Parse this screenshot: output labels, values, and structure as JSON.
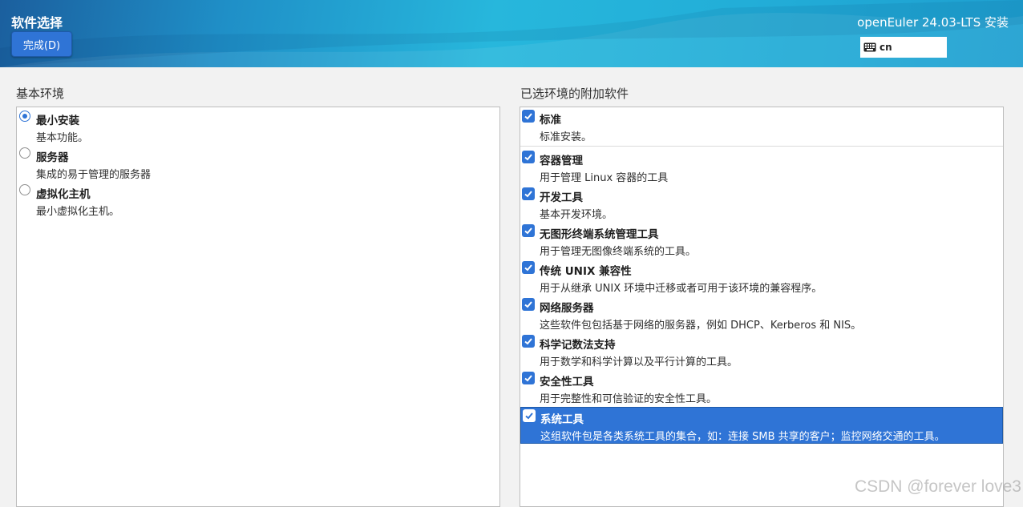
{
  "header": {
    "title": "软件选择",
    "done_label": "完成(D)",
    "product": "openEuler 24.03-LTS 安装",
    "keyboard_layout": "cn",
    "keyboard_icon": "keyboard-icon"
  },
  "base_env": {
    "label": "基本环境",
    "selected_index": 0,
    "items": [
      {
        "name": "最小安装",
        "desc": "基本功能。"
      },
      {
        "name": "服务器",
        "desc": "集成的易于管理的服务器"
      },
      {
        "name": "虚拟化主机",
        "desc": "最小虚拟化主机。"
      }
    ]
  },
  "addons": {
    "label": "已选环境的附加软件",
    "highlighted_index": 8,
    "items": [
      {
        "name": "标准",
        "desc": "标准安装。",
        "checked": true
      },
      {
        "name": "容器管理",
        "desc": "用于管理 Linux 容器的工具",
        "checked": true
      },
      {
        "name": "开发工具",
        "desc": "基本开发环境。",
        "checked": true
      },
      {
        "name": "无图形终端系统管理工具",
        "desc": "用于管理无图像终端系统的工具。",
        "checked": true
      },
      {
        "name": "传统 UNIX 兼容性",
        "desc": "用于从继承 UNIX 环境中迁移或者可用于该环境的兼容程序。",
        "checked": true
      },
      {
        "name": "网络服务器",
        "desc": "这些软件包包括基于网络的服务器，例如 DHCP、Kerberos 和 NIS。",
        "checked": true
      },
      {
        "name": "科学记数法支持",
        "desc": "用于数学和科学计算以及平行计算的工具。",
        "checked": true
      },
      {
        "name": "安全性工具",
        "desc": "用于完整性和可信验证的安全性工具。",
        "checked": true
      },
      {
        "name": "系统工具",
        "desc": "这组软件包是各类系统工具的集合，如：连接 SMB 共享的客户；监控网络交通的工具。",
        "checked": true
      }
    ]
  },
  "colors": {
    "accent": "#2f74d6",
    "header_start": "#1b5f9e",
    "header_end": "#27b7dc"
  },
  "watermark": "CSDN @forever love3"
}
